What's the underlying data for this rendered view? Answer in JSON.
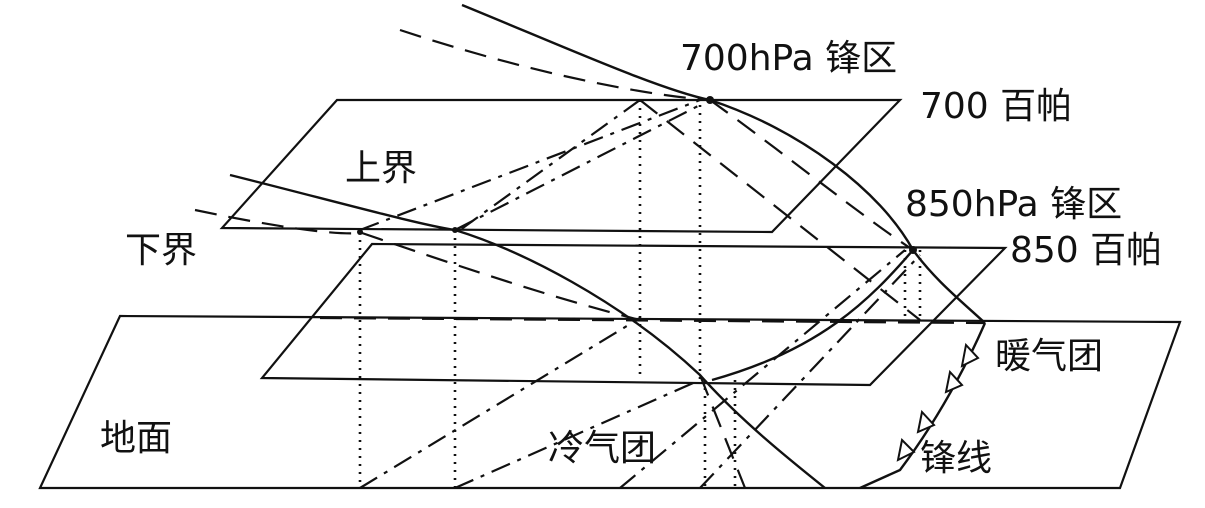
{
  "labels": {
    "front_700": "700hPa 锋区",
    "level_700": "700 百帕",
    "upper_bound": "上界",
    "front_850": "850hPa 锋区",
    "lower_bound": "下界",
    "level_850": "850 百帕",
    "warm_air": "暖气团",
    "ground": "地面",
    "cold_air": "冷气团",
    "front_line": "锋线"
  },
  "colors": {
    "ink": "#111111",
    "background": "#ffffff"
  }
}
